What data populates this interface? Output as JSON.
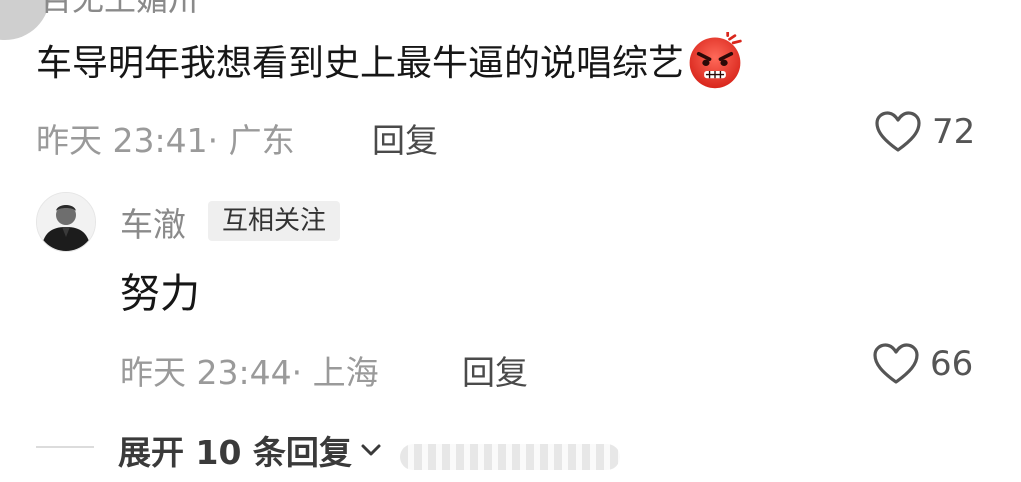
{
  "top": {
    "username": "百无王媚卅"
  },
  "comment": {
    "text": "车导明年我想看到史上最牛逼的说唱综艺",
    "emoji": "angry-face-icon",
    "time": "昨天 23:41",
    "location_sep": "·",
    "location": "广东",
    "reply_label": "回复",
    "likes": "72"
  },
  "reply": {
    "username": "车澈",
    "badge": "互相关注",
    "text": "努力",
    "time": "昨天 23:44",
    "location_sep": "·",
    "location": "上海",
    "reply_label": "回复",
    "likes": "66"
  },
  "expand": {
    "label": "展开 10 条回复"
  },
  "colors": {
    "meta_gray": "#9a9a9a",
    "badge_bg": "#efefef",
    "emoji_red": "#e53935"
  }
}
